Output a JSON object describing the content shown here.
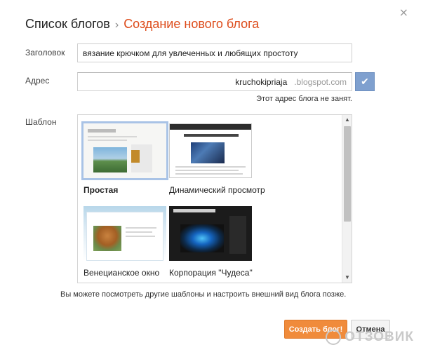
{
  "dialog": {
    "close_glyph": "×",
    "breadcrumb": {
      "root": "Список блогов",
      "separator": "›",
      "current": "Создание нового блога"
    }
  },
  "form": {
    "title_label": "Заголовок",
    "title_value": "вязание крючком для увлеченных и любящих простоту",
    "address_label": "Адрес",
    "address_value": "kruchokipriaja",
    "address_suffix": ".blogspot.com",
    "check_glyph": "✔",
    "address_status": "Этот адрес блога не занят.",
    "template_label": "Шаблон"
  },
  "templates": [
    {
      "name": "Простая",
      "selected": true
    },
    {
      "name": "Динамический просмотр",
      "selected": false
    },
    {
      "name": "Венецианское окно",
      "selected": false
    },
    {
      "name": "Корпорация \"Чудеса\"",
      "selected": false
    }
  ],
  "scroll": {
    "up_glyph": "▲",
    "down_glyph": "▼"
  },
  "note": "Вы можете посмотреть другие шаблоны и настроить внешний вид блога позже.",
  "buttons": {
    "create_label": "Создать блог!",
    "cancel_label": "Отмена"
  },
  "watermark": {
    "text": "ОТЗОВИК"
  },
  "colors": {
    "accent": "#dd4b1a",
    "create_button": "#f08b3b",
    "check_button": "#7fa0cf",
    "selected_outline": "#a9c3e6"
  }
}
